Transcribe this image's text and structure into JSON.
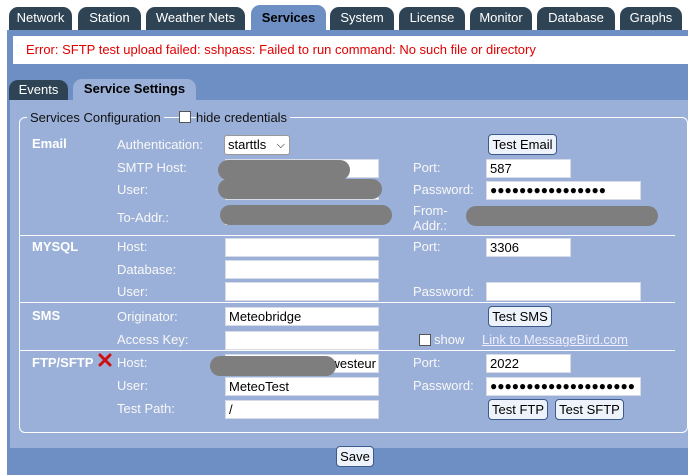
{
  "top_tabs": [
    "Network",
    "Station",
    "Weather Nets",
    "Services",
    "System",
    "License",
    "Monitor",
    "Database",
    "Graphs"
  ],
  "error_message": "Error: SFTP test upload failed: sshpass: Failed to run command: No such file or directory",
  "sub_tabs": [
    "Events",
    "Service Settings"
  ],
  "config": {
    "legend": "Services Configuration",
    "hide_credentials_label": "hide credentials"
  },
  "email": {
    "section": "Email",
    "auth_label": "Authentication:",
    "auth_value": "starttls",
    "test_button": "Test Email",
    "smtp_label": "SMTP Host:",
    "port_label": "Port:",
    "port_value": "587",
    "user_label": "User:",
    "password_label": "Password:",
    "password_value": "●●●●●●●●●●●●●●●●",
    "to_label": "To-Addr.:",
    "from_label_1": "From-",
    "from_label_2": "Addr.:"
  },
  "mysql": {
    "section": "MYSQL",
    "host_label": "Host:",
    "port_label": "Port:",
    "port_value": "3306",
    "database_label": "Database:",
    "user_label": "User:",
    "password_label": "Password:"
  },
  "sms": {
    "section": "SMS",
    "originator_label": "Originator:",
    "originator_value": "Meteobridge",
    "test_button": "Test SMS",
    "access_key_label": "Access Key:",
    "show_label": "show",
    "link_text": "Link to MessageBird.com"
  },
  "ftp": {
    "section": "FTP/SFTP",
    "host_label": "Host:",
    "host_visible": "westeur",
    "port_label": "Port:",
    "port_value": "2022",
    "user_label": "User:",
    "user_value": "MeteoTest",
    "password_label": "Password:",
    "password_value": "●●●●●●●●●●●●●●●●●●●●",
    "test_path_label": "Test Path:",
    "test_path_value": "/",
    "test_ftp_button": "Test FTP",
    "test_sftp_button": "Test SFTP"
  },
  "save_button": "Save"
}
